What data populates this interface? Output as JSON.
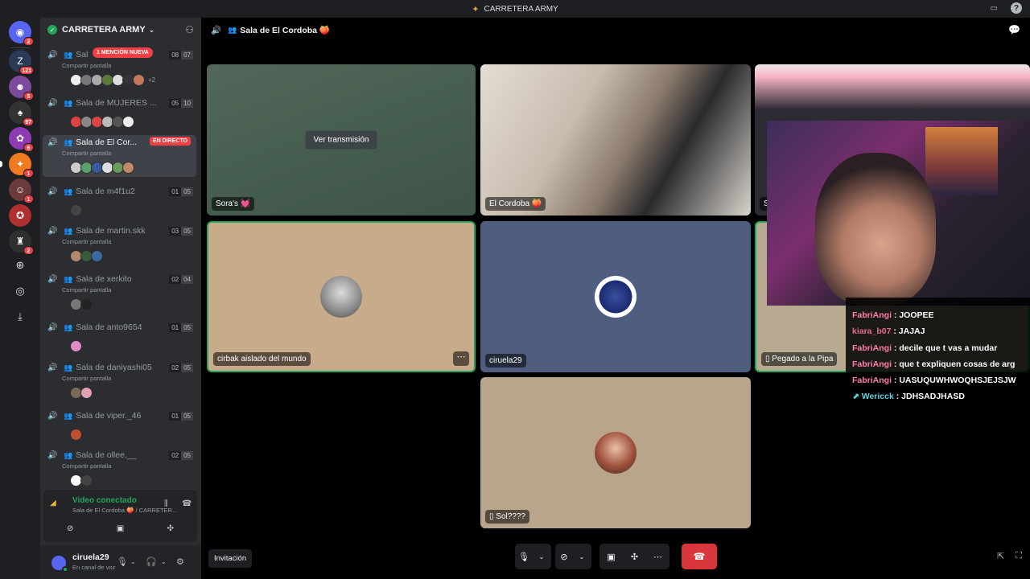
{
  "window": {
    "title": "CARRETERA ARMY"
  },
  "rail": {
    "badges": [
      "2",
      "121",
      "5",
      "97",
      "6",
      "1",
      "1",
      "2"
    ]
  },
  "server": {
    "name": "CARRETERA ARMY"
  },
  "channels": [
    {
      "name": "Sal",
      "sub": "Compartir pantalla",
      "count_a": "08",
      "count_b": "07",
      "mention": "1 MENCIÓN NUEVA",
      "extra": "+2"
    },
    {
      "name": "Sala de MUJERES ...",
      "sub": "",
      "count_a": "05",
      "count_b": "10"
    },
    {
      "name": "Sala de El Cor...",
      "sub": "Compartir pantalla",
      "live": "EN DIRECTO"
    },
    {
      "name": "Sala de m4f1u2",
      "sub": "",
      "count_a": "01",
      "count_b": "05"
    },
    {
      "name": "Sala de martin.skk",
      "sub": "Compartir pantalla",
      "count_a": "03",
      "count_b": "05"
    },
    {
      "name": "Sala de xerkito",
      "sub": "Compartir pantalla",
      "count_a": "02",
      "count_b": "04"
    },
    {
      "name": "Sala de anto9654",
      "sub": "",
      "count_a": "01",
      "count_b": "05"
    },
    {
      "name": "Sala de daniyashi05",
      "sub": "Compartir pantalla",
      "count_a": "02",
      "count_b": "05"
    },
    {
      "name": "Sala de viper._46",
      "sub": "",
      "count_a": "01",
      "count_b": "05"
    },
    {
      "name": "Sala de ollee.__",
      "sub": "Compartir pantalla",
      "count_a": "02",
      "count_b": "05"
    }
  ],
  "voice": {
    "status": "Video conectado",
    "location": "Sala de El Cordoba 🍑 / CARRETER..."
  },
  "user": {
    "name": "ciruela29",
    "status": "En canal de voz"
  },
  "stage": {
    "channel_title": "Sala de El Cordoba 🍑",
    "watch_stream": "Ver transmisión",
    "invite": "Invitación"
  },
  "tiles": {
    "t1": "Sora's 💓",
    "t2": "El Cordoba 🍑",
    "t3": "S",
    "t4": "cirbak aislado del mundo",
    "t5": "ciruela29",
    "t6": "Pegado a la Pipa",
    "t7": "Sol????"
  },
  "chat": [
    {
      "nick": "FabriAngi",
      "text": " : JOOPEE",
      "cls": ""
    },
    {
      "nick": "kiara_b07",
      "text": " : JAJAJ",
      "cls": "k"
    },
    {
      "nick": "FabriAngi",
      "text": " : decile que t vas a mudar",
      "cls": ""
    },
    {
      "nick": "FabriAngi",
      "text": " : que t expliquen cosas de arg",
      "cls": ""
    },
    {
      "nick": "FabriAngi",
      "text": " : UASUQUWHWOQHSJEJSJW",
      "cls": ""
    },
    {
      "nick": "Wericck",
      "text": " : JDHSADJHASD",
      "cls": "w"
    }
  ],
  "colors": {
    "accent": "#5865f2",
    "green": "#23a55a",
    "red": "#da373c"
  }
}
